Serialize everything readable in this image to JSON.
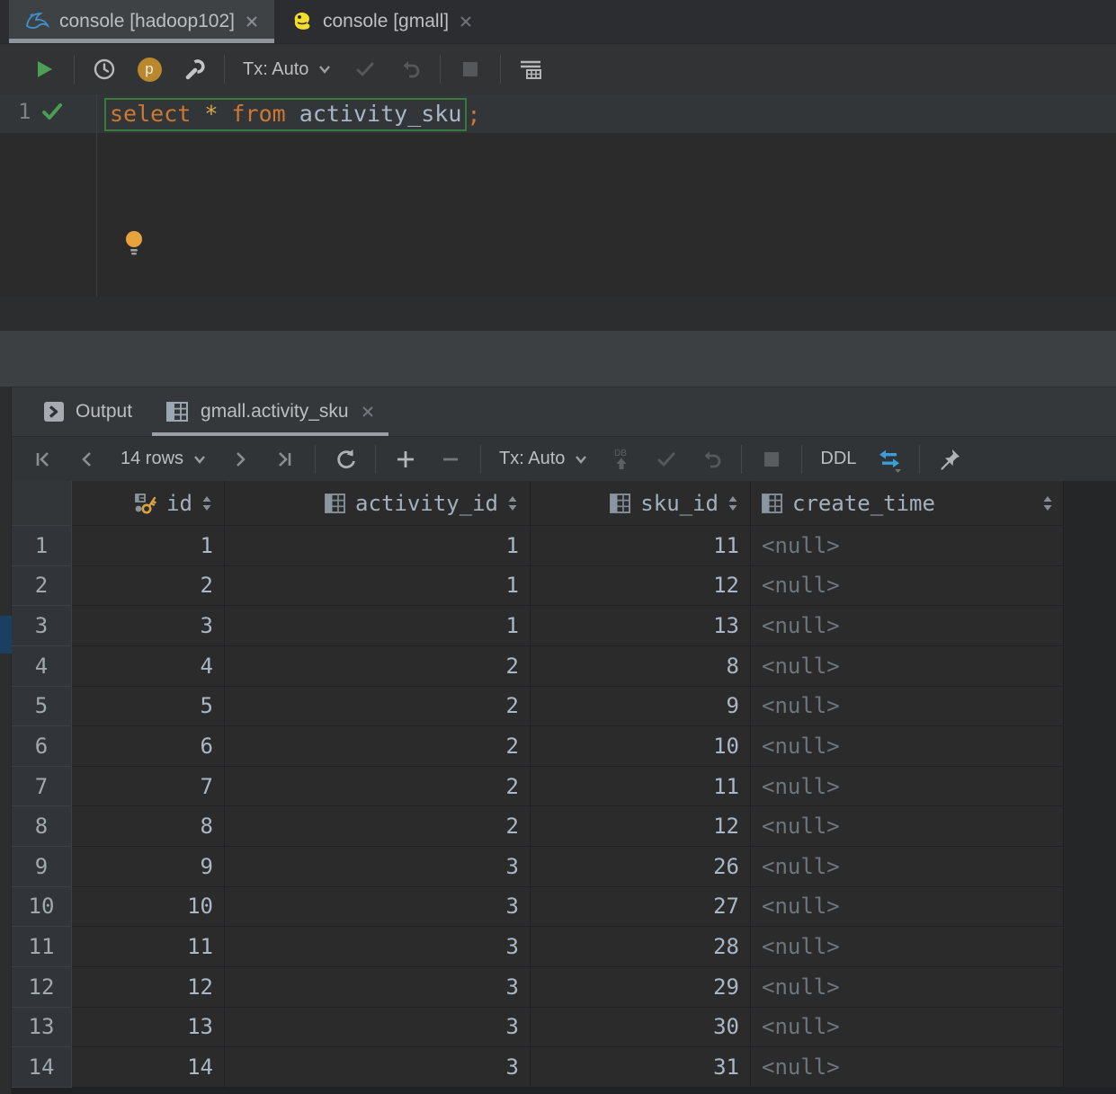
{
  "editor_tabs": [
    {
      "label": "console [hadoop102]",
      "icon": "mysql-dolphin-icon",
      "active": true
    },
    {
      "label": "console [gmall]",
      "icon": "mariadb-seal-icon",
      "active": false
    }
  ],
  "editor_toolbar": {
    "tx_label": "Tx: Auto",
    "profile_badge": "p"
  },
  "editor": {
    "line_number": "1",
    "sql": "select * from activity_sku;",
    "tokens": [
      {
        "t": "select",
        "c": "kw"
      },
      {
        "t": " ",
        "c": "plain"
      },
      {
        "t": "*",
        "c": "star"
      },
      {
        "t": " ",
        "c": "plain"
      },
      {
        "t": "from",
        "c": "kw"
      },
      {
        "t": " ",
        "c": "plain"
      },
      {
        "t": "activity_sku",
        "c": "ident"
      }
    ],
    "semicolon": ";"
  },
  "output_panel": {
    "tabs": [
      {
        "label": "Output",
        "icon": "run-console-icon",
        "active": false
      },
      {
        "label": "gmall.activity_sku",
        "icon": "table-grid-icon",
        "active": true
      }
    ],
    "toolbar": {
      "rows_label": "14 rows",
      "tx_label": "Tx: Auto",
      "ddl_label": "DDL"
    }
  },
  "table": {
    "columns": [
      {
        "name": "id",
        "icon": "primary-key-icon"
      },
      {
        "name": "activity_id",
        "icon": "column-icon"
      },
      {
        "name": "sku_id",
        "icon": "column-icon"
      },
      {
        "name": "create_time",
        "icon": "column-icon"
      }
    ],
    "rows": [
      {
        "n": "1",
        "cells": [
          "1",
          "1",
          "11",
          "<null>"
        ]
      },
      {
        "n": "2",
        "cells": [
          "2",
          "1",
          "12",
          "<null>"
        ]
      },
      {
        "n": "3",
        "cells": [
          "3",
          "1",
          "13",
          "<null>"
        ]
      },
      {
        "n": "4",
        "cells": [
          "4",
          "2",
          "8",
          "<null>"
        ]
      },
      {
        "n": "5",
        "cells": [
          "5",
          "2",
          "9",
          "<null>"
        ]
      },
      {
        "n": "6",
        "cells": [
          "6",
          "2",
          "10",
          "<null>"
        ]
      },
      {
        "n": "7",
        "cells": [
          "7",
          "2",
          "11",
          "<null>"
        ]
      },
      {
        "n": "8",
        "cells": [
          "8",
          "2",
          "12",
          "<null>"
        ]
      },
      {
        "n": "9",
        "cells": [
          "9",
          "3",
          "26",
          "<null>"
        ]
      },
      {
        "n": "10",
        "cells": [
          "10",
          "3",
          "27",
          "<null>"
        ]
      },
      {
        "n": "11",
        "cells": [
          "11",
          "3",
          "28",
          "<null>"
        ]
      },
      {
        "n": "12",
        "cells": [
          "12",
          "3",
          "29",
          "<null>"
        ]
      },
      {
        "n": "13",
        "cells": [
          "13",
          "3",
          "30",
          "<null>"
        ]
      },
      {
        "n": "14",
        "cells": [
          "14",
          "3",
          "31",
          "<null>"
        ]
      }
    ]
  },
  "colors": {
    "keyword": "#CC7832",
    "star": "#D8A848",
    "identifier": "#A9B7C6",
    "accent_blue": "#3B9EDA",
    "key_gold": "#D9A343",
    "run_green": "#4D9E55",
    "bulb": "#E8A33D",
    "stripe_marker": "#1B3F60"
  }
}
